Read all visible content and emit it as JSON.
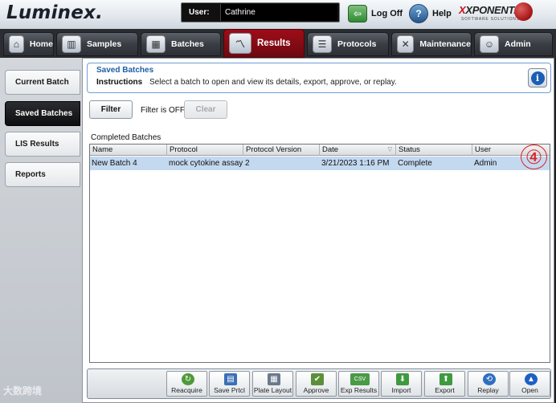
{
  "app": {
    "logo": "Luminex."
  },
  "header": {
    "user_label": "User:",
    "user_value": "Cathrine",
    "logoff_label": "Log Off",
    "help_label": "Help",
    "xponent_brand": "XPONENT.",
    "xponent_sub": "SOFTWARE SOLUTIONS"
  },
  "nav": {
    "tabs": [
      {
        "label": "Home",
        "icon": "home-icon"
      },
      {
        "label": "Samples",
        "icon": "samples-icon"
      },
      {
        "label": "Batches",
        "icon": "batches-icon"
      },
      {
        "label": "Results",
        "icon": "results-chart-icon",
        "active": true
      },
      {
        "label": "Protocols",
        "icon": "protocols-icon"
      },
      {
        "label": "Maintenance",
        "icon": "maintenance-icon"
      },
      {
        "label": "Admin",
        "icon": "admin-icon"
      }
    ]
  },
  "sidebar": {
    "items": [
      {
        "label": "Current Batch"
      },
      {
        "label": "Saved Batches",
        "active": true
      },
      {
        "label": "LIS Results"
      },
      {
        "label": "Reports"
      }
    ]
  },
  "instructions": {
    "title": "Saved Batches",
    "label": "Instructions",
    "text": "Select a batch to open and view its details, export, approve, or replay."
  },
  "filter": {
    "button_label": "Filter",
    "status": "Filter is OFF",
    "clear_label": "Clear"
  },
  "grid": {
    "caption": "Completed Batches",
    "columns": [
      "Name",
      "Protocol",
      "Protocol Version",
      "Date",
      "Status",
      "User"
    ],
    "rows": [
      {
        "name": "New Batch 4",
        "protocol": "mock cytokine assay",
        "version": "2",
        "date": "3/21/2023 1:16 PM",
        "status": "Complete",
        "user": "Admin"
      }
    ],
    "annotation": "④"
  },
  "toolbar": {
    "buttons": [
      {
        "label": "Reacquire",
        "icon": "reacquire-icon",
        "color": "#4f9a3a"
      },
      {
        "label": "Save Prtcl",
        "icon": "save-protocol-icon",
        "color": "#3b6fb6"
      },
      {
        "label": "Plate Layout",
        "icon": "plate-layout-icon",
        "color": "#6b7a8b"
      },
      {
        "label": "Approve",
        "icon": "approve-icon",
        "color": "#5c8f3a"
      },
      {
        "label": "Exp Results",
        "icon": "export-csv-icon",
        "color": "#4a9a47"
      },
      {
        "label": "Import",
        "icon": "import-icon",
        "color": "#3f9a3f"
      },
      {
        "label": "Export",
        "icon": "export-icon",
        "color": "#3f9a3f"
      },
      {
        "label": "Replay",
        "icon": "replay-icon",
        "color": "#2f6fc0"
      },
      {
        "label": "Open",
        "icon": "open-icon",
        "color": "#1e5fc4"
      }
    ]
  },
  "watermark": "大数跨境"
}
